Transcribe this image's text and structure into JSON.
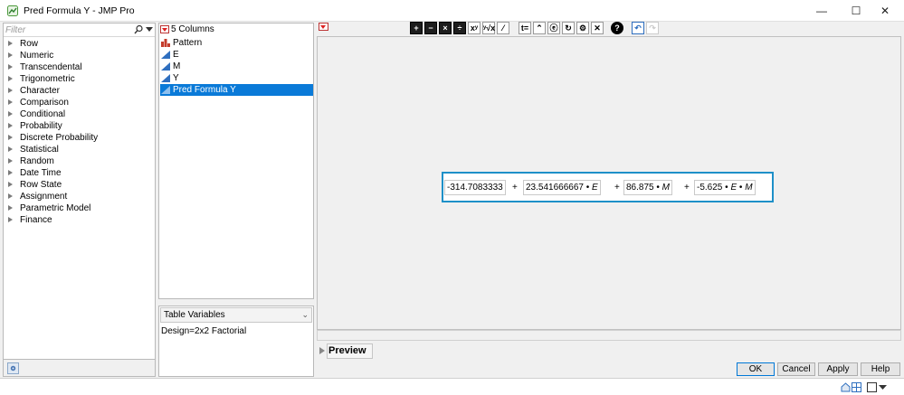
{
  "window": {
    "title": "Pred Formula Y - JMP Pro",
    "minimize": "—",
    "maximize": "☐",
    "close": "✕"
  },
  "functions": {
    "filter_placeholder": "Filter",
    "items": [
      "Row",
      "Numeric",
      "Transcendental",
      "Trigonometric",
      "Character",
      "Comparison",
      "Conditional",
      "Probability",
      "Discrete Probability",
      "Statistical",
      "Random",
      "Date Time",
      "Row State",
      "Assignment",
      "Parametric Model",
      "Finance"
    ]
  },
  "columns": {
    "count_label": "5 Columns",
    "items": [
      {
        "label": "Pattern",
        "icon": "nominal-bar-icon"
      },
      {
        "label": "E",
        "icon": "continuous-icon"
      },
      {
        "label": "M",
        "icon": "continuous-icon"
      },
      {
        "label": "Y",
        "icon": "continuous-icon"
      },
      {
        "label": "Pred Formula Y",
        "icon": "continuous-icon",
        "selected": true
      }
    ]
  },
  "table_variables": {
    "select_label": "Table Variables",
    "value": "Design=2x2 Factorial"
  },
  "toolbar": {
    "buttons": [
      {
        "name": "plus-button",
        "label": "+"
      },
      {
        "name": "minus-button",
        "label": "−"
      },
      {
        "name": "multiply-button",
        "label": "×"
      },
      {
        "name": "divide-button",
        "label": "÷"
      },
      {
        "name": "power-button",
        "label": "xʸ"
      },
      {
        "name": "root-button",
        "label": "ʸ√x"
      },
      {
        "name": "fraction-button",
        "label": "⁄"
      },
      {
        "name": "assign-button",
        "label": "t="
      },
      {
        "name": "peel-button",
        "label": "⌃"
      },
      {
        "name": "local-button",
        "label": "ⓔ"
      },
      {
        "name": "refresh-button",
        "label": "↻"
      },
      {
        "name": "fire-button",
        "label": "⚙"
      },
      {
        "name": "delete-button",
        "label": "✕"
      },
      {
        "name": "help-button",
        "label": "?"
      },
      {
        "name": "undo-button",
        "label": "↶"
      },
      {
        "name": "redo-button",
        "label": "↷"
      }
    ]
  },
  "formula": {
    "t1": "-314.7083333",
    "op1": "+",
    "t2": "23.541666667",
    "dot": "•",
    "v_e": "E",
    "op2": "+",
    "t3": "86.875",
    "v_m": "M",
    "op3": "+",
    "t4": "-5.625"
  },
  "preview": {
    "label": "Preview"
  },
  "buttons": {
    "ok": "OK",
    "cancel": "Cancel",
    "apply": "Apply",
    "help": "Help"
  },
  "colors": {
    "selection": "#0a7ad8",
    "formula_border": "#1e90c8",
    "menu_red": "#d22222"
  }
}
